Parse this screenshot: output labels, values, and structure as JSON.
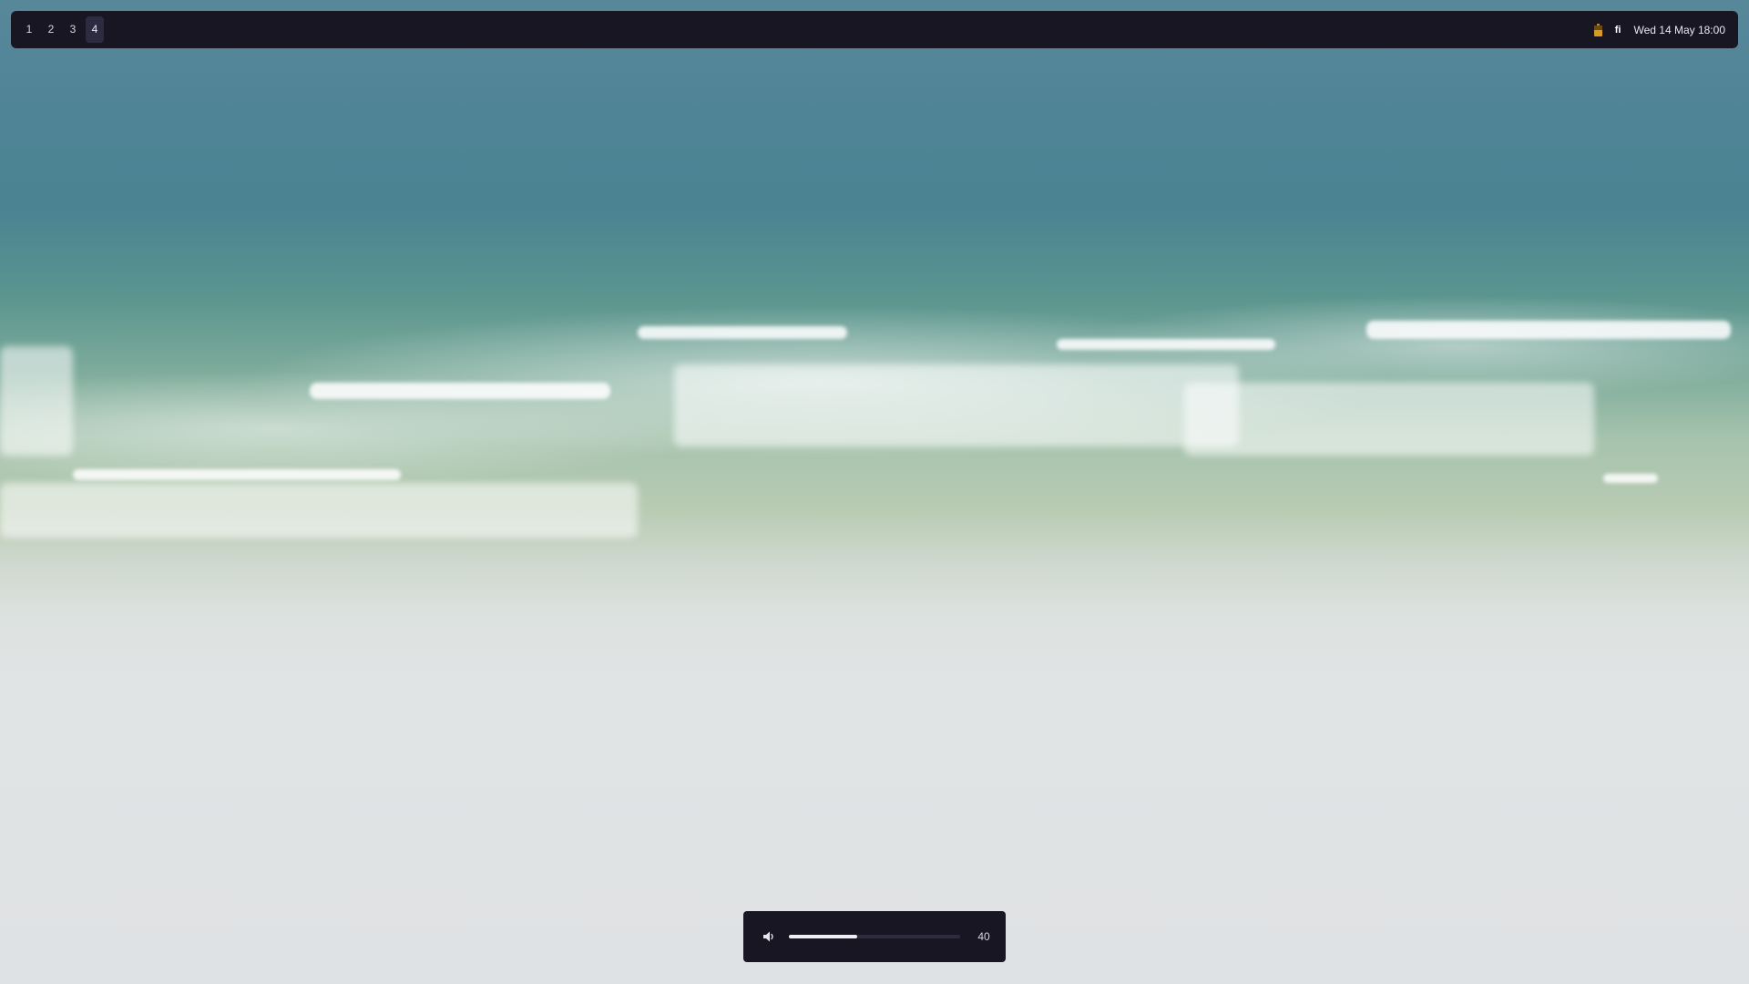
{
  "wallpaper": {
    "description_icon": "beach-wallpaper"
  },
  "topbar": {
    "workspaces": [
      {
        "label": "1",
        "active": false
      },
      {
        "label": "2",
        "active": false
      },
      {
        "label": "3",
        "active": false
      },
      {
        "label": "4",
        "active": true
      }
    ],
    "tray": {
      "battery_icon": "battery-icon",
      "battery_color": "#d89a21",
      "layout_indicator": "fi",
      "clock": "Wed 14 May 18:00"
    }
  },
  "volume_osd": {
    "icon": "speaker-icon",
    "level": 40,
    "value_text": "40"
  },
  "colors": {
    "bar_bg": "#171622",
    "workspace_active_bg": "#2c2b40",
    "accent": "#eeeef4"
  }
}
